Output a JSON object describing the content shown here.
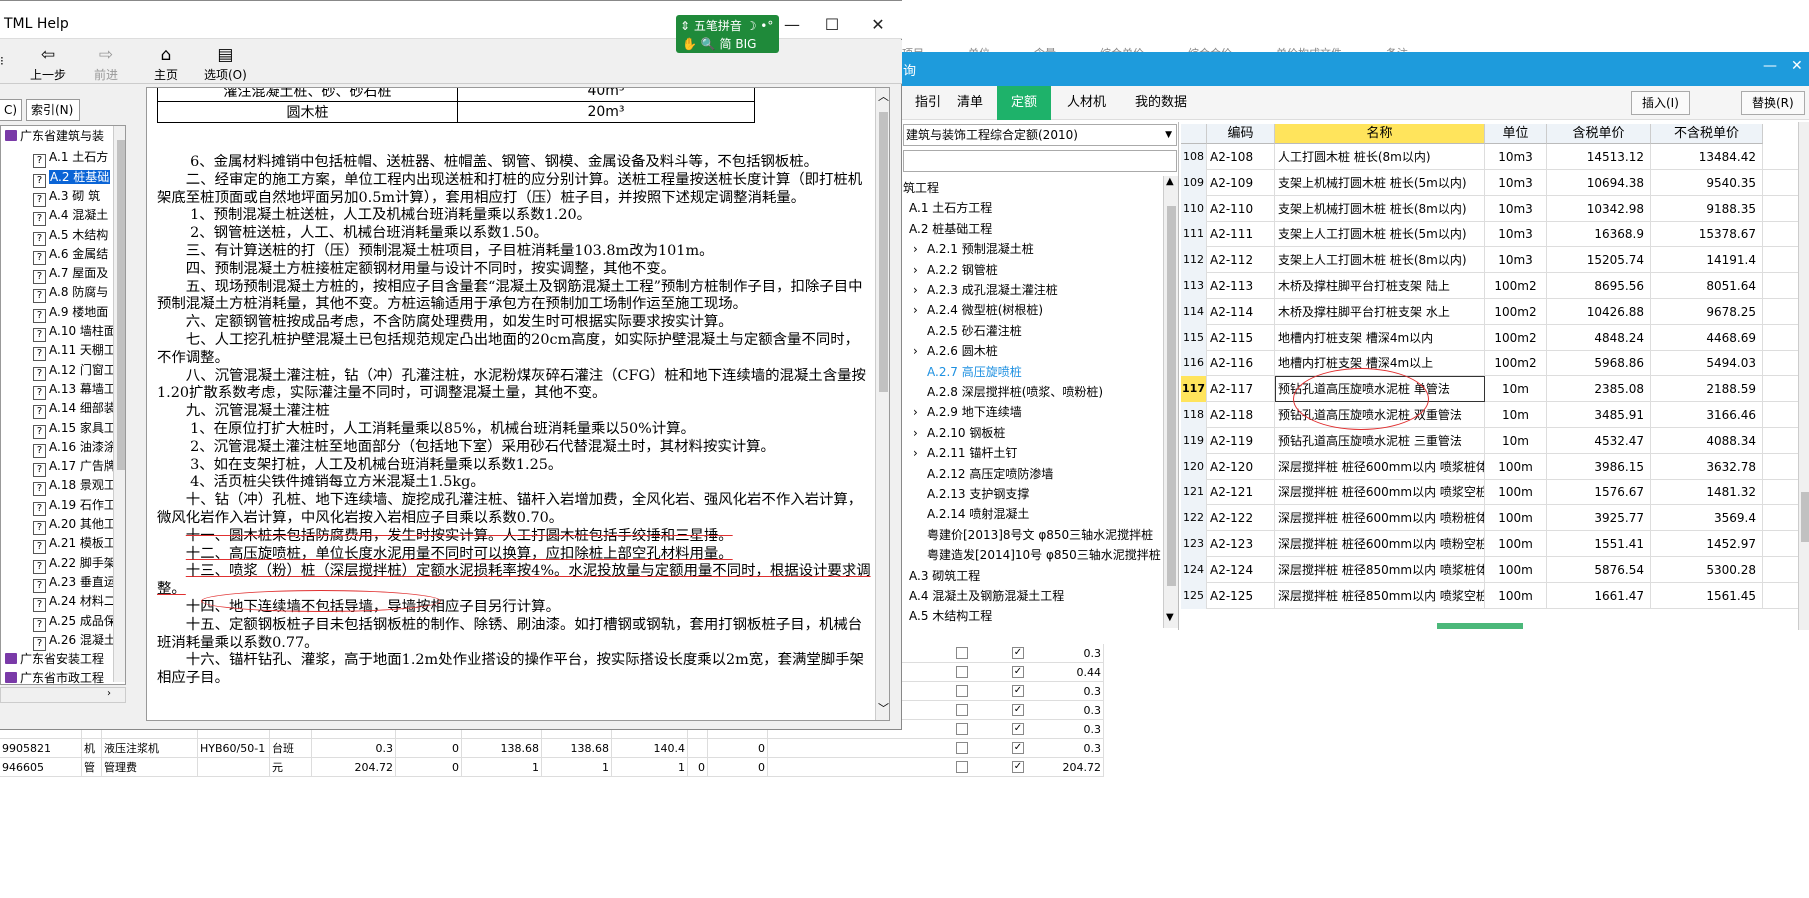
{
  "help": {
    "title": "TML Help",
    "buttons": {
      "minimize": "—",
      "maximize": "☐",
      "close": "✕"
    },
    "toolbar": [
      {
        "label": "上一步",
        "icon": "⇦",
        "disabled": false
      },
      {
        "label": "前进",
        "icon": "⇨",
        "disabled": true
      },
      {
        "label": "主页",
        "icon": "⌂",
        "disabled": false
      },
      {
        "label": "选项(O)",
        "icon": "▤",
        "disabled": false
      }
    ],
    "nav_tabs": [
      "C)",
      "索引(N)"
    ],
    "tree": [
      {
        "label": "广东省建筑与装",
        "type": "book"
      },
      {
        "label": "A.1 土石方",
        "type": "page"
      },
      {
        "label": "A.2 桩基础",
        "type": "page",
        "selected": true
      },
      {
        "label": "A.3 砌 筑",
        "type": "page"
      },
      {
        "label": "A.4 混凝土",
        "type": "page"
      },
      {
        "label": "A.5 木结构",
        "type": "page"
      },
      {
        "label": "A.6 金属结",
        "type": "page"
      },
      {
        "label": "A.7 屋面及",
        "type": "page"
      },
      {
        "label": "A.8 防腐与",
        "type": "page"
      },
      {
        "label": "A.9 楼地面",
        "type": "page"
      },
      {
        "label": "A.10 墙柱面",
        "type": "page"
      },
      {
        "label": "A.11 天棚工",
        "type": "page"
      },
      {
        "label": "A.12 门窗工",
        "type": "page"
      },
      {
        "label": "A.13 幕墙工",
        "type": "page"
      },
      {
        "label": "A.14 细部装",
        "type": "page"
      },
      {
        "label": "A.15 家具工",
        "type": "page"
      },
      {
        "label": "A.16 油漆涂",
        "type": "page"
      },
      {
        "label": "A.17 广告牌",
        "type": "page"
      },
      {
        "label": "A.18 景观工",
        "type": "page"
      },
      {
        "label": "A.19 石作工",
        "type": "page"
      },
      {
        "label": "A.20 其他工",
        "type": "page"
      },
      {
        "label": "A.21 模板工",
        "type": "page"
      },
      {
        "label": "A.22 脚手架",
        "type": "page"
      },
      {
        "label": "A.23 垂直运",
        "type": "page"
      },
      {
        "label": "A.24 材料二",
        "type": "page"
      },
      {
        "label": "A.25 成品保",
        "type": "page"
      },
      {
        "label": "A.26 混凝土",
        "type": "page"
      },
      {
        "label": "广东省安装工程",
        "type": "book"
      },
      {
        "label": "广东省市政工程",
        "type": "book"
      }
    ],
    "table": [
      [
        "灌注混凝土桩、砂、砂石桩",
        "40m³"
      ],
      [
        "圆木桩",
        "20m³"
      ]
    ],
    "paragraphs": [
      "6、金属材料摊销中包括桩帽、送桩器、桩帽盖、钢管、钢模、金属设备及料斗等，不包括钢板桩。",
      "二、经审定的施工方案，单位工程内出现送桩和打桩的应分别计算。送桩工程量按送桩长度计算（即打桩机架底至桩顶面或自然地坪面另加0.5m计算），套用相应打（压）桩子目，并按照下述规定调整消耗量。",
      "1、预制混凝土桩送桩，人工及机械台班消耗量乘以系数1.20。",
      "2、钢管桩送桩，人工、机械台班消耗量乘以系数1.50。",
      "三、有计算送桩的打（压）预制混凝土桩项目，子目桩消耗量103.8m改为101m。",
      "四、预制混凝土方桩接桩定额钢材用量与设计不同时，按实调整，其他不变。",
      "五、现场预制混凝土方桩的，按相应子目含量套“混凝土及钢筋混凝土工程”预制方桩制作子目，扣除子目中预制混凝土方桩消耗量，其他不变。方桩运输适用于承包方在预制加工场制作运至施工现场。",
      "六、定额钢管桩按成品考虑，不含防腐处理费用，如发生时可根据实际要求按实计算。",
      "七、人工挖孔桩护壁混凝土已包括规范规定凸出地面的20cm高度，如实际护壁混凝土与定额含量不同时，不作调整。",
      "八、沉管混凝土灌注桩，钻（冲）孔灌注桩，水泥粉煤灰碎石灌注（CFG）桩和地下连续墙的混凝土含量按1.20扩散系数考虑，实际灌注量不同时，可调整混凝土量，其他不变。",
      "九、沉管混凝土灌注桩",
      "1、在原位打扩大桩时，人工消耗量乘以85%，机械台班消耗量乘以50%计算。",
      "2、沉管混凝土灌注桩至地面部分（包括地下室）采用砂石代替混凝土时，其材料按实计算。",
      "3、如在支架打桩，人工及机械台班消耗量乘以系数1.25。",
      "4、活页桩尖铁件摊销每立方米混凝土1.5kg。",
      "十、钻（冲）孔桩、地下连续墙、旋挖成孔灌注桩、锚杆入岩增加费，全风化岩、强风化岩不作入岩计算，微风化岩作入岩计算，中风化岩按入岩相应子目乘以系数0.70。",
      "十一、圆木桩未包括防腐费用，发生时按实计算。人工打圆木桩包括手绞捶和三星捶。",
      "十二、高压旋喷桩，单位长度水泥用量不同时可以换算，应扣除桩上部空孔材料用量。",
      "十三、喷浆（粉）桩（深层搅拌桩）定额水泥损耗率按4%。水泥投放量与定额用量不同时，根据设计要求调整。",
      "十四、地下连续墙不包括导墙，导墙按相应子目另行计算。",
      "十五、定额钢板桩子目未包括钢板桩的制作、除锈、刷油漆。如打槽钢或钢轨，套用打钢板桩子目，机械台班消耗量乘以系数0.77。",
      "十六、锚杆钻孔、灌浆，高于地面1.2m处作业搭设的操作平台，按实际搭设长度乘以2m宽，套满堂脚手架相应子目。"
    ]
  },
  "ime": {
    "line1": "五笔拼音",
    "line2": "简",
    "line2b": "BIG"
  },
  "query": {
    "title": "询",
    "tabs": [
      "指引",
      "清单",
      "定额",
      "人材机",
      "我的数据"
    ],
    "active_tab": "定额",
    "buttons": [
      "插入(I)",
      "替换(R)"
    ],
    "combo": "建筑与装饰工程综合定额(2010)",
    "tree": [
      {
        "label": "筑工程",
        "indent": 0
      },
      {
        "label": "A.1 土石方工程",
        "indent": 1
      },
      {
        "label": "A.2 桩基础工程",
        "indent": 1
      },
      {
        "label": "A.2.1 预制混凝土桩",
        "indent": 2,
        "arrow": true
      },
      {
        "label": "A.2.2 钢管桩",
        "indent": 2,
        "arrow": true
      },
      {
        "label": "A.2.3 成孔混凝土灌注桩",
        "indent": 2,
        "arrow": true
      },
      {
        "label": "A.2.4 微型桩(树根桩)",
        "indent": 2,
        "arrow": true
      },
      {
        "label": "A.2.5 砂石灌注桩",
        "indent": 2
      },
      {
        "label": "A.2.6 圆木桩",
        "indent": 2,
        "arrow": true
      },
      {
        "label": "A.2.7 高压旋喷桩",
        "indent": 2,
        "hl": true
      },
      {
        "label": "A.2.8 深层搅拌桩(喷浆、喷粉桩)",
        "indent": 2
      },
      {
        "label": "A.2.9 地下连续墙",
        "indent": 2,
        "arrow": true
      },
      {
        "label": "A.2.10 钢板桩",
        "indent": 2,
        "arrow": true
      },
      {
        "label": "A.2.11 锚杆土钉",
        "indent": 2,
        "arrow": true
      },
      {
        "label": "A.2.12 高压定喷防渗墙",
        "indent": 2
      },
      {
        "label": "A.2.13 支护钢支撑",
        "indent": 2
      },
      {
        "label": "A.2.14 喷射混凝土",
        "indent": 2
      },
      {
        "label": "粤建价[2013]8号文 φ850三轴水泥搅拌桩",
        "indent": 2
      },
      {
        "label": "粤建造发[2014]10号 φ850三轴水泥搅拌桩",
        "indent": 2
      },
      {
        "label": "A.3 砌筑工程",
        "indent": 1
      },
      {
        "label": "A.4 混凝土及钢筋混凝土工程",
        "indent": 1
      },
      {
        "label": "A.5 木结构工程",
        "indent": 1
      }
    ],
    "columns": [
      "",
      "编码",
      "名称",
      "单位",
      "含税单价",
      "不含税单价"
    ],
    "rows": [
      [
        "108",
        "A2-108",
        "人工打圆木桩 桩长(8m以内)",
        "10m3",
        "14513.12",
        "13484.42"
      ],
      [
        "109",
        "A2-109",
        "支架上机械打圆木桩 桩长(5m以内)",
        "10m3",
        "10694.38",
        "9540.35"
      ],
      [
        "110",
        "A2-110",
        "支架上机械打圆木桩 桩长(8m以内)",
        "10m3",
        "10342.98",
        "9188.35"
      ],
      [
        "111",
        "A2-111",
        "支架上人工打圆木桩 桩长(5m以内)",
        "10m3",
        "16368.9",
        "15378.67"
      ],
      [
        "112",
        "A2-112",
        "支架上人工打圆木桩 桩长(8m以内)",
        "10m3",
        "15205.74",
        "14191.4"
      ],
      [
        "113",
        "A2-113",
        "木桥及撑柱脚平台打桩支架 陆上",
        "100m2",
        "8695.56",
        "8051.64"
      ],
      [
        "114",
        "A2-114",
        "木桥及撑柱脚平台打桩支架 水上",
        "100m2",
        "10426.88",
        "9678.25"
      ],
      [
        "115",
        "A2-115",
        "地槽内打桩支架 槽深4m以内",
        "100m2",
        "4848.24",
        "4468.69"
      ],
      [
        "116",
        "A2-116",
        "地槽内打桩支架 槽深4m以上",
        "100m2",
        "5968.86",
        "5494.03"
      ],
      [
        "117",
        "A2-117",
        "预钻孔道高压旋喷水泥桩 单管法",
        "10m",
        "2385.08",
        "2188.59"
      ],
      [
        "118",
        "A2-118",
        "预钻孔道高压旋喷水泥桩 双重管法",
        "10m",
        "3485.91",
        "3166.46"
      ],
      [
        "119",
        "A2-119",
        "预钻孔道高压旋喷水泥桩 三重管法",
        "10m",
        "4532.47",
        "4088.34"
      ],
      [
        "120",
        "A2-120",
        "深层搅拌桩 桩径600mm以内 喷浆桩体",
        "100m",
        "3986.15",
        "3632.78"
      ],
      [
        "121",
        "A2-121",
        "深层搅拌桩 桩径600mm以内 喷浆空桩",
        "100m",
        "1576.67",
        "1481.32"
      ],
      [
        "122",
        "A2-122",
        "深层搅拌桩 桩径600mm以内 喷粉桩体",
        "100m",
        "3925.77",
        "3569.4"
      ],
      [
        "123",
        "A2-123",
        "深层搅拌桩 桩径600mm以内 喷粉空桩",
        "100m",
        "1551.41",
        "1452.97"
      ],
      [
        "124",
        "A2-124",
        "深层搅拌桩 桩径850mm以内 喷浆桩体",
        "100m",
        "5876.54",
        "5300.28"
      ],
      [
        "125",
        "A2-125",
        "深层搅拌桩 桩径850mm以内 喷浆空桩",
        "100m",
        "1661.47",
        "1561.45"
      ]
    ],
    "current_row": "117"
  },
  "bottom": {
    "rows": [
      {
        "code": "",
        "type": "",
        "name": "",
        "spec": "",
        "unit": "",
        "v1": "",
        "v2": "",
        "v3": "",
        "v4": "",
        "v5": "",
        "v6": "",
        "v7": "",
        "last": "0.3"
      },
      {
        "code": "",
        "type": "",
        "name": "",
        "spec": "",
        "unit": "",
        "v1": "",
        "v2": "",
        "v3": "",
        "v4": "",
        "v5": "",
        "v6": "",
        "v7": "",
        "last": "0.44"
      },
      {
        "code": "",
        "type": "",
        "name": "",
        "spec": "",
        "unit": "",
        "v1": "",
        "v2": "",
        "v3": "",
        "v4": "",
        "v5": "",
        "v6": "",
        "v7": "",
        "last": "0.3"
      },
      {
        "code": "",
        "type": "",
        "name": "",
        "spec": "",
        "unit": "",
        "v1": "",
        "v2": "",
        "v3": "",
        "v4": "",
        "v5": "",
        "v6": "",
        "v7": "",
        "last": "0.3"
      },
      {
        "code": "",
        "type": "",
        "name": "",
        "spec": "",
        "unit": "",
        "v1": "",
        "v2": "",
        "v3": "",
        "v4": "",
        "v5": "",
        "v6": "",
        "v7": "",
        "last": "0.3"
      },
      {
        "code": "9905821",
        "type": "机",
        "name": "液压注浆机",
        "spec": "HYB60/50-1",
        "unit": "台班",
        "v1": "0.3",
        "v2": "0",
        "v3": "138.68",
        "v4": "138.68",
        "v5": "140.4",
        "v6": "",
        "v7": "0",
        "last": "0.3"
      },
      {
        "code": "946605",
        "type": "管",
        "name": "管理费",
        "spec": "",
        "unit": "元",
        "v1": "204.72",
        "v2": "0",
        "v3": "1",
        "v4": "1",
        "v5": "1",
        "v6": "0",
        "v7": "0",
        "last": "204.72"
      }
    ]
  },
  "top_strip": [
    "项目",
    "单位",
    "含量",
    "综合单价",
    "综合合价",
    "单价构成文件",
    "备注"
  ]
}
